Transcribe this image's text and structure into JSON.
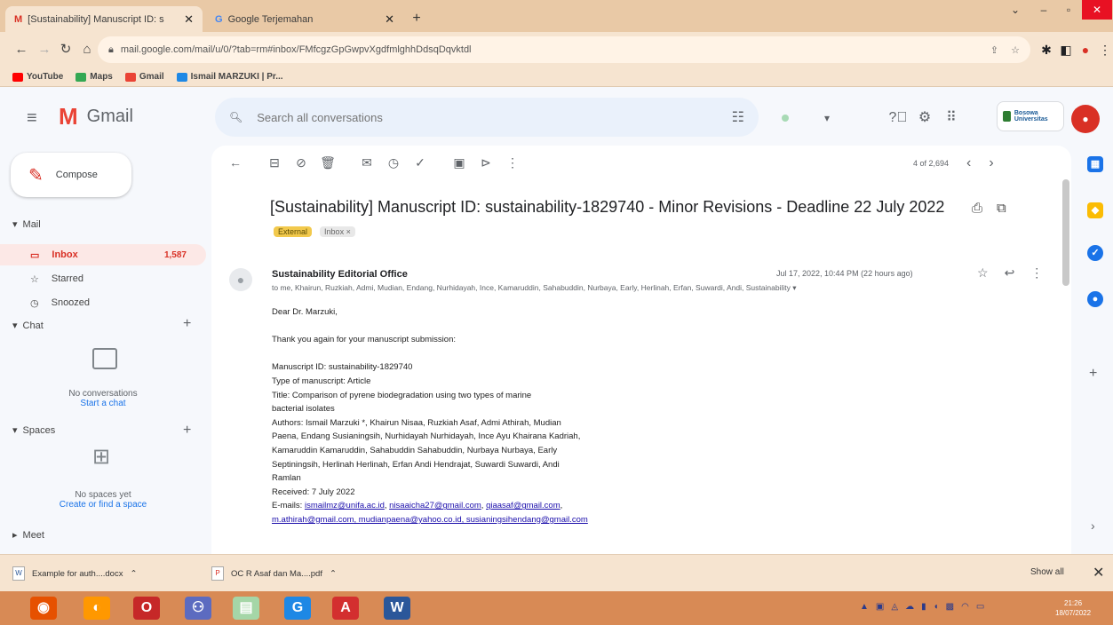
{
  "browser": {
    "tabs": [
      {
        "title": "[Sustainability] Manuscript ID: s",
        "active": true
      },
      {
        "title": "Google Terjemahan",
        "active": false
      }
    ],
    "url": "mail.google.com/mail/u/0/?tab=rm#inbox/FMfcgzGpGwpvXgdfmlghhDdsqDqvktdl",
    "bookmarks": [
      "YouTube",
      "Maps",
      "Gmail",
      "Ismail MARZUKI | Pr..."
    ]
  },
  "gmail": {
    "product_name": "Gmail",
    "search_placeholder": "Search all conversations",
    "org_badge": "Bosowa Universitas"
  },
  "nav": {
    "compose": "Compose",
    "mail_header": "Mail",
    "items": [
      {
        "label": "Inbox",
        "count": "1,587"
      },
      {
        "label": "Starred",
        "count": ""
      },
      {
        "label": "Snoozed",
        "count": ""
      }
    ],
    "chat_header": "Chat",
    "chat_empty": "No conversations",
    "chat_link": "Start a chat",
    "spaces_header": "Spaces",
    "spaces_empty": "No spaces yet",
    "spaces_link": "Create or find a space",
    "meet_header": "Meet"
  },
  "toolbar": {
    "pager": "4 of 2,694"
  },
  "email": {
    "subject": "[Sustainability] Manuscript ID: sustainability-1829740 - Minor Revisions - Deadline 22 July 2022",
    "label_external": "External",
    "label_inbox": "Inbox ×",
    "sender": "Sustainability Editorial Office",
    "recipients": "to me, Khairun, Ruzkiah, Admi, Mudian, Endang, Nurhidayah, Ince, Kamaruddin, Sahabuddin, Nurbaya, Early, Herlinah, Erfan, Suwardi, Andi, Sustainability ▾",
    "date": "Jul 17, 2022, 10:44 PM (22 hours ago)",
    "body": {
      "greeting": "Dear Dr. Marzuki,",
      "line1": "Thank you again for your manuscript submission:",
      "ms_id": "Manuscript ID: sustainability-1829740",
      "type": "Type of manuscript: Article",
      "title1": "Title: Comparison of pyrene biodegradation using two types of marine",
      "title2": "bacterial isolates",
      "authors1": "Authors: Ismail Marzuki *, Khairun Nisaa, Ruzkiah Asaf, Admi Athirah, Mudian",
      "authors2": "Paena, Endang Susianingsih, Nurhidayah Nurhidayah, Ince Ayu Khairana Kadriah,",
      "authors3": "Kamaruddin Kamaruddin, Sahabuddin Sahabuddin, Nurbaya Nurbaya, Early",
      "authors4": "Septiningsih, Herlinah Herlinah, Erfan Andi Hendrajat, Suwardi Suwardi, Andi",
      "authors5": "Ramlan",
      "received": "Received: 7 July 2022",
      "emails_label": "E-mails:",
      "email1": "ismailmz@unifa.ac.id",
      "email2": "nisaaicha27@gmail.com",
      "email3": "qiaasaf@gmail.com",
      "emails_line2": "m.athirah@gmail.com, mudianpaena@yahoo.co.id, susianingsihendang@gmail.com"
    }
  },
  "downloads": {
    "items": [
      "Example for auth....docx",
      "OC R Asaf dan Ma....pdf"
    ],
    "show_all": "Show all"
  },
  "taskbar": {
    "time": "21:26",
    "date": "18/07/2022"
  },
  "colors": {
    "chrome_frame": "#e9c9a6",
    "gmail_red": "#d93025",
    "taskbar": "#d88a55"
  }
}
